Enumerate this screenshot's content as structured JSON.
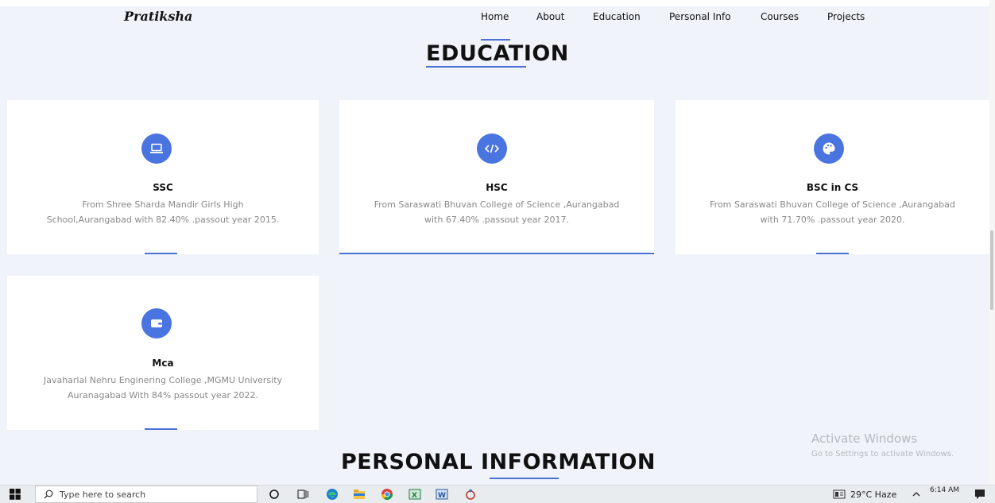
{
  "brand": "Pratiksha",
  "nav": [
    "Home",
    "About",
    "Education",
    "Personal Info",
    "Courses",
    "Projects"
  ],
  "education_title": "EDUCATION",
  "cards": [
    {
      "icon": "laptop-icon",
      "title": "SSC",
      "line1": "From Shree Sharda Mandir Girls High",
      "line2": "School,Aurangabad with 82.40% .passout year 2015."
    },
    {
      "icon": "code-icon",
      "title": "HSC",
      "line1": "From Saraswati Bhuvan College of Science ,Aurangabad",
      "line2": "with 67.40% .passout year 2017."
    },
    {
      "icon": "palette-icon",
      "title": "BSC in CS",
      "line1": "From Saraswati Bhuvan College of Science ,Aurangabad",
      "line2": "with 71.70% .passout year 2020."
    },
    {
      "icon": "wallet-icon",
      "title": "Mca",
      "line1": "Javaharlal Nehru Enginering College ,MGMU University",
      "line2": "Auranagabad With 84% passout year 2022."
    }
  ],
  "personal_title": "PERSONAL INFORMATION",
  "watermark": {
    "title": "Activate Windows",
    "subtitle": "Go to Settings to activate Windows."
  },
  "taskbar": {
    "search_placeholder": "Type here to search",
    "weather": "29°C  Haze",
    "time": "6:14 AM",
    "apps": [
      "cortana-icon",
      "task-view-icon",
      "edge-icon",
      "file-explorer-icon",
      "chrome-icon",
      "excel-icon",
      "word-icon",
      "app-icon"
    ]
  },
  "colors": {
    "accent": "#4a6fd8",
    "icon_bg": "#4a74df",
    "page_bg": "#f0f4fa"
  }
}
